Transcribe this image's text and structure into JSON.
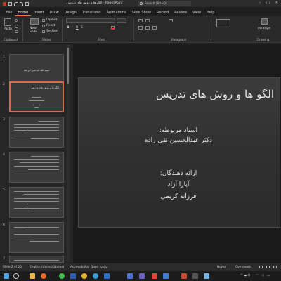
{
  "titlebar": {
    "doc_title": "الگو ها و روش های تدریس  -  PowerPoint",
    "search_placeholder": "Search (Alt+Q)",
    "minimize": "–",
    "maximize": "□",
    "close": "✕"
  },
  "ribbon_tabs": [
    "File",
    "Home",
    "Insert",
    "Draw",
    "Design",
    "Transitions",
    "Animations",
    "Slide Show",
    "Record",
    "Review",
    "View",
    "Help"
  ],
  "active_tab": "Home",
  "ribbon": {
    "paste_label": "Paste",
    "new_slide_label": "New\nSlide",
    "layout_label": "Layout",
    "reset_label": "Reset",
    "section_label": "Section",
    "arrange_label": "Arrange",
    "groups": {
      "clipboard": "Clipboard",
      "slides": "Slides",
      "font": "Font",
      "paragraph": "Paragraph",
      "drawing": "Drawing"
    }
  },
  "thumbnails": [
    {
      "num": "1",
      "text": "بسم الله الرحمن الرحیم"
    },
    {
      "num": "2",
      "text": "الگو ها و روش های تدریس"
    },
    {
      "num": "3",
      "text": ""
    },
    {
      "num": "4",
      "text": ""
    },
    {
      "num": "5",
      "text": ""
    },
    {
      "num": "6",
      "text": ""
    },
    {
      "num": "7",
      "text": ""
    }
  ],
  "slide": {
    "title": "الگو ها و روش های تدریس",
    "teacher_label": "استاد مربوطه:",
    "teacher_name": "دکتر عبدالحسین نقی زاده",
    "presenters_label": "ارائه دهندگان:",
    "presenter_1": "آیارا آزاد",
    "presenter_2": "فرزانه کریمی"
  },
  "statusbar": {
    "slide_info": "Slide 2 of 20",
    "language": "English (United States)",
    "accessibility": "Accessibility: Good to go",
    "notes": "Notes",
    "comments": "Comments"
  },
  "colors": {
    "accent": "#d86a4e",
    "background": "#1e1e1e"
  }
}
